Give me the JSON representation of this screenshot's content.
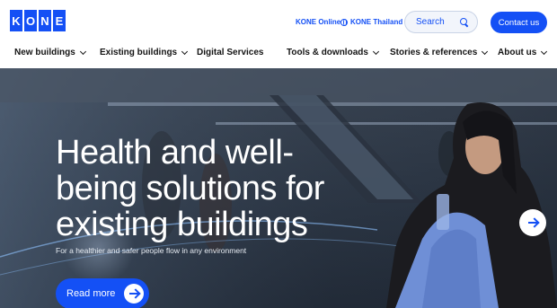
{
  "brand": {
    "logo_letters": [
      "K",
      "O",
      "N",
      "E"
    ],
    "color": "#1450f5"
  },
  "topbar": {
    "kone_online": "KONE Online",
    "kone_thailand": "KONE Thailand",
    "search_placeholder": "Search",
    "contact_label": "Contact us"
  },
  "nav": {
    "items": [
      {
        "label": "New buildings",
        "has_dropdown": true
      },
      {
        "label": "Existing buildings",
        "has_dropdown": true
      },
      {
        "label": "Digital Services",
        "has_dropdown": false
      },
      {
        "label": "Tools & downloads",
        "has_dropdown": true
      },
      {
        "label": "Stories & references",
        "has_dropdown": true
      },
      {
        "label": "About us",
        "has_dropdown": true
      }
    ]
  },
  "hero": {
    "headline": "Health and well-being solutions for existing buildings",
    "subtitle": "For a healthier and safer people flow in any environment",
    "cta_label": "Read more"
  }
}
